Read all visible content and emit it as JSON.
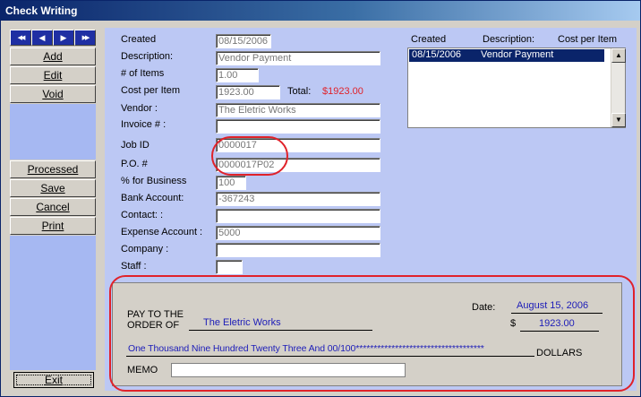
{
  "window": {
    "title": "Check Writing"
  },
  "nav": {
    "first_icon": "double-left-arrow",
    "prev_icon": "left-arrow",
    "next_icon": "right-arrow",
    "last_icon": "double-right-arrow",
    "first": "◀◀",
    "prev": "◀",
    "next": "▶",
    "last": "▶▶"
  },
  "actions": {
    "add": "Add",
    "edit": "Edit",
    "void": "Void",
    "processed": "Processed",
    "save": "Save",
    "cancel": "Cancel",
    "print": "Print",
    "exit": "Exit"
  },
  "form": {
    "created_label": "Created",
    "created_value": "08/15/2006",
    "description_label": "Description:",
    "description_value": "Vendor Payment",
    "items_label": "# of Items",
    "items_value": "1.00",
    "cost_label": "Cost per Item",
    "cost_value": "1923.00",
    "total_label": "Total:",
    "total_value": "$1923.00",
    "vendor_label": "Vendor :",
    "vendor_value": "The Eletric Works",
    "invoice_label": "Invoice # :",
    "invoice_value": "",
    "jobid_label": "Job ID",
    "jobid_value": "0000017",
    "po_label": "P.O. #",
    "po_value": "0000017P02",
    "business_label": "% for Business",
    "business_value": "100",
    "bank_label": "Bank Account:",
    "bank_value": "-367243",
    "contact_label": "Contact: :",
    "contact_value": "",
    "expense_label": "Expense Account :",
    "expense_value": "5000",
    "company_label": "Company :",
    "company_value": "",
    "staff_label": "Staff :",
    "staff_value": ""
  },
  "list": {
    "headers": [
      "Created",
      "Description:",
      "Cost per Item"
    ],
    "rows": [
      {
        "created": "08/15/2006",
        "description": "Vendor Payment"
      }
    ]
  },
  "check": {
    "pay_to_line1": "PAY TO THE",
    "pay_to_line2": "ORDER OF",
    "payee": "The Eletric Works",
    "date_label": "Date:",
    "date_value": "August 15, 2006",
    "dollar_sign": "$",
    "amount": "1923.00",
    "amount_words": "One Thousand Nine Hundred Twenty Three And 00/100************************************",
    "dollars_label": "DOLLARS",
    "memo_label": "MEMO",
    "memo_value": ""
  },
  "colors": {
    "titlebar": "#0a246a",
    "panel": "#bcc8f4",
    "annotation": "#e0222a",
    "total": "#e0222a",
    "check_text": "#1c1cb8"
  }
}
